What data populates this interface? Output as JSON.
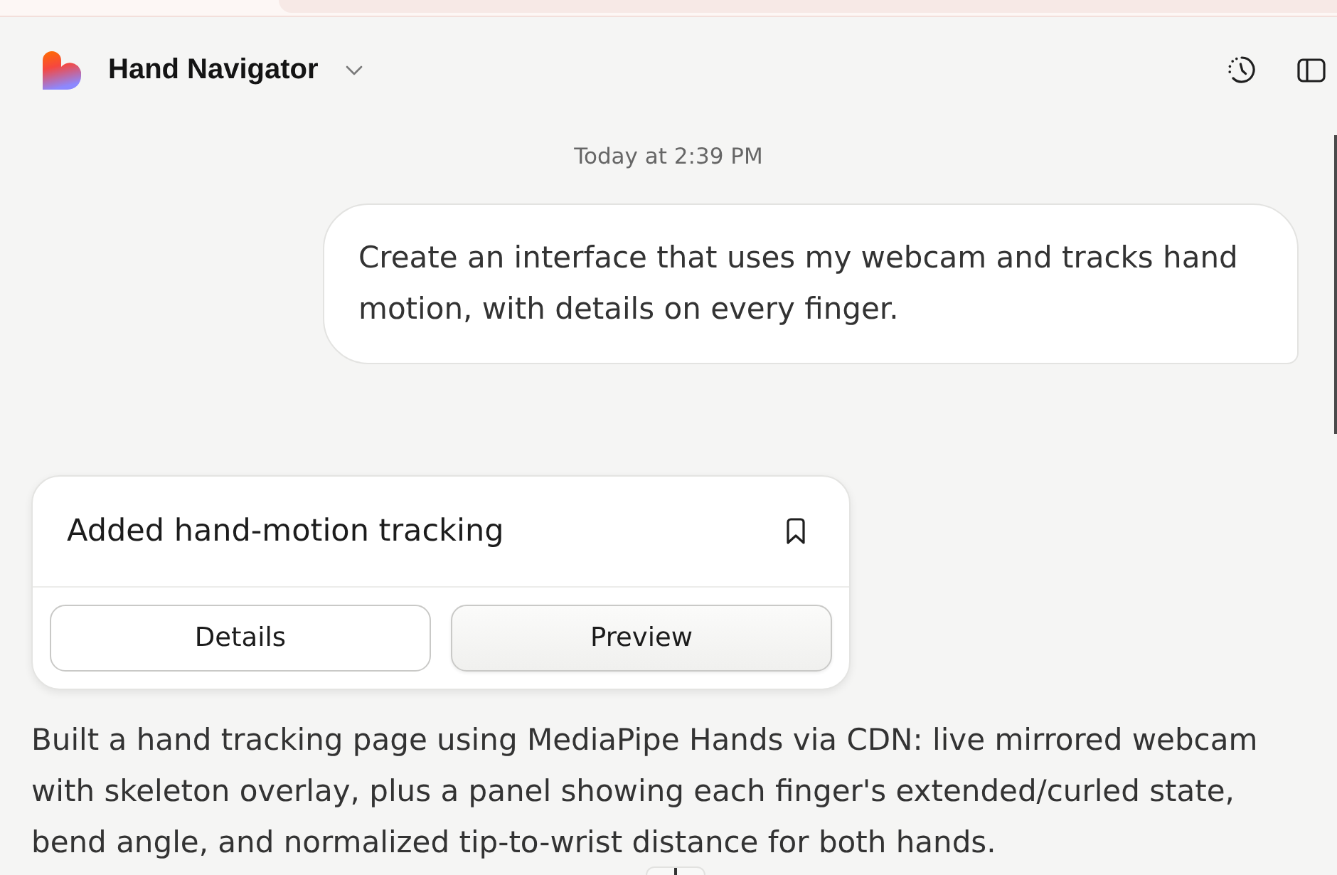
{
  "header": {
    "title": "Hand Navigator"
  },
  "timestamp": "Today at 2:39 PM",
  "user_message": {
    "text": "Create an interface that uses my webcam and tracks hand motion, with details on every finger."
  },
  "artifact_card": {
    "title": "Added hand-motion tracking",
    "buttons": [
      {
        "label": "Details",
        "kind": "plain"
      },
      {
        "label": "Preview",
        "kind": "shaded"
      }
    ]
  },
  "response": {
    "text": "Built a hand tracking page using MediaPipe Hands via CDN: live mirrored webcam with skeleton overlay, plus a panel showing each finger's extended/curled state, bend angle, and normalized tip-to-wrist distance for both hands."
  }
}
